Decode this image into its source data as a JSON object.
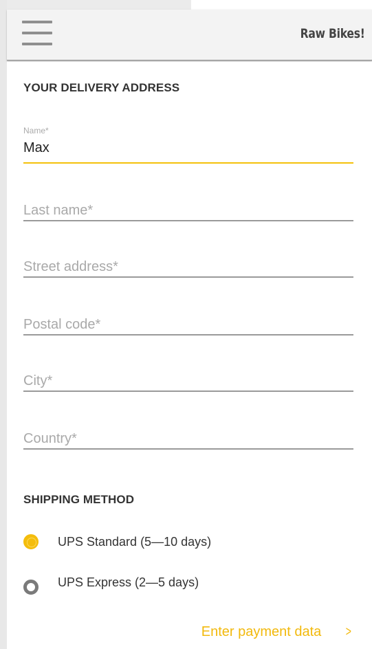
{
  "header": {
    "title": "Raw Bikes!"
  },
  "address_section": {
    "title": "YOUR DELIVERY ADDRESS",
    "name": {
      "label": "Name*",
      "value": "Max"
    },
    "last_name": {
      "placeholder": "Last name*",
      "value": ""
    },
    "street": {
      "placeholder": "Street address*",
      "value": ""
    },
    "postal_code": {
      "placeholder": "Postal code*",
      "value": ""
    },
    "city": {
      "placeholder": "City*",
      "value": ""
    },
    "country": {
      "placeholder": "Country*",
      "value": ""
    }
  },
  "shipping_section": {
    "title": "SHIPPING METHOD",
    "options": [
      {
        "label": "UPS Standard (5—10 days)",
        "selected": true
      },
      {
        "label": "UPS Express (2—5 days)",
        "selected": false
      }
    ]
  },
  "footer": {
    "next_label": "Enter payment data",
    "next_icon": "chevron-right-icon"
  },
  "colors": {
    "accent": "#f4bd0c",
    "underline": "#9a9a9a",
    "app_bar": "#f3f3f3"
  }
}
